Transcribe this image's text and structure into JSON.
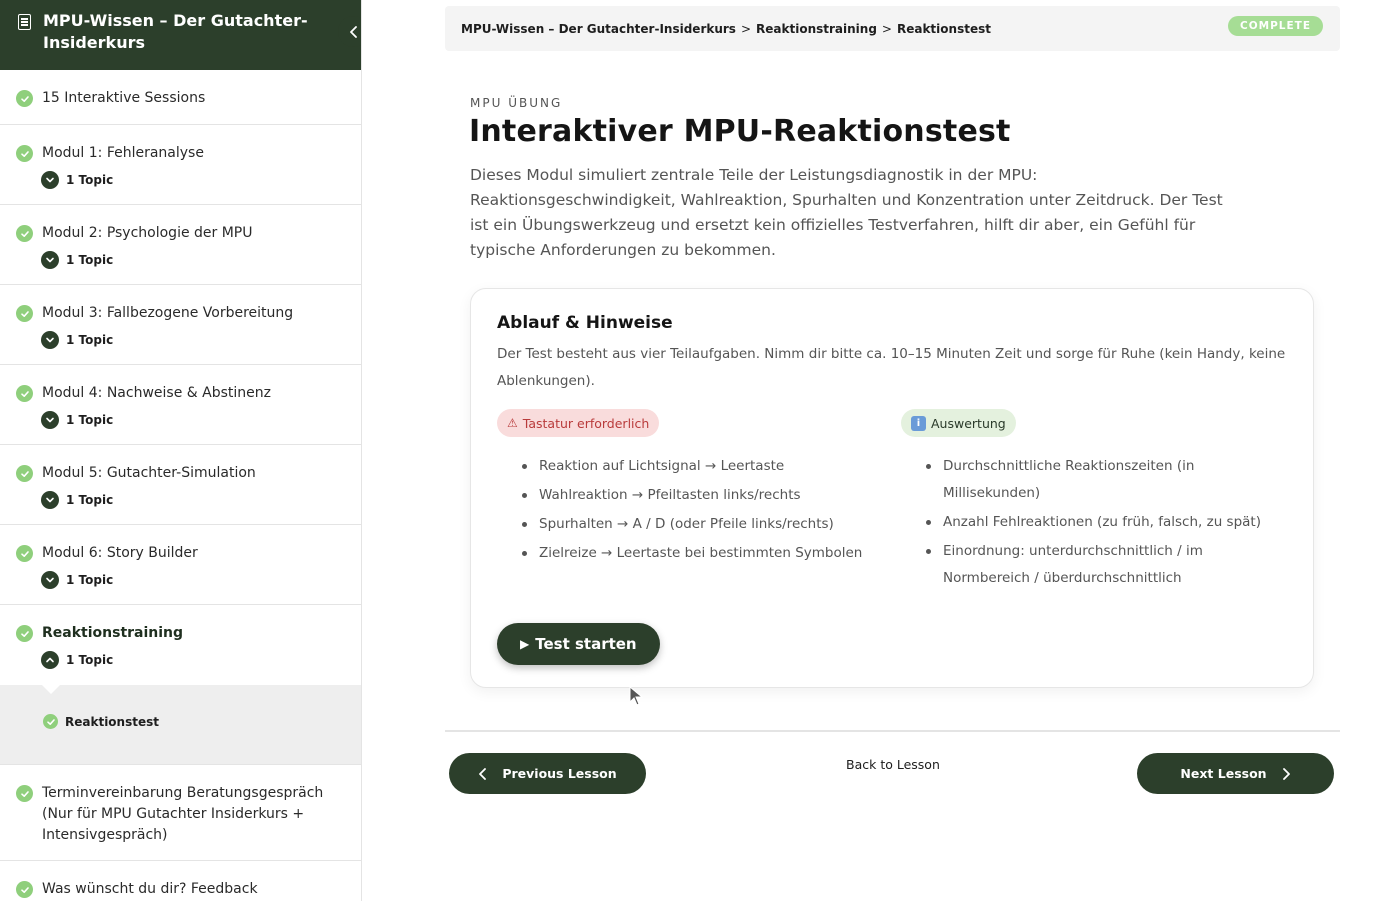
{
  "sidebar": {
    "title": "MPU-Wissen – Der Gutachter-Insiderkurs",
    "items": [
      {
        "label": "15 Interaktive Sessions"
      },
      {
        "label": "Modul 1: Fehleranalyse",
        "topics": "1 Topic"
      },
      {
        "label": "Modul 2: Psychologie der MPU",
        "topics": "1 Topic"
      },
      {
        "label": "Modul 3: Fallbezogene Vorbereitung",
        "topics": "1 Topic"
      },
      {
        "label": "Modul 4: Nachweise & Abstinenz",
        "topics": "1 Topic"
      },
      {
        "label": "Modul 5: Gutachter-Simulation",
        "topics": "1 Topic"
      },
      {
        "label": "Modul 6: Story Builder",
        "topics": "1 Topic"
      },
      {
        "label": "Reaktionstraining",
        "topics": "1 Topic"
      },
      {
        "label": "Terminvereinbarung Beratungsgespräch (Nur für MPU Gutachter Insiderkurs + Intensivgespräch)"
      },
      {
        "label": "Was wünscht du dir? Feedback"
      }
    ],
    "sub_item": "Reaktionstest"
  },
  "breadcrumb": {
    "items": [
      "MPU-Wissen – Der Gutachter-Insiderkurs",
      "Reaktionstraining",
      "Reaktionstest"
    ],
    "separator": ">",
    "status": "COMPLETE"
  },
  "lesson": {
    "eyebrow": "MPU ÜBUNG",
    "title": "Interaktiver MPU-Reaktionstest",
    "intro": "Dieses Modul simuliert zentrale Teile der Leistungsdiagnostik in der MPU: Reaktionsgeschwindigkeit, Wahlreaktion, Spurhalten und Konzentration unter Zeitdruck. Der Test ist ein Übungswerkzeug und ersetzt kein offizielles Testverfahren, hilft dir aber, ein Gefühl für typische Anforderungen zu bekommen."
  },
  "card": {
    "title": "Ablauf & Hinweise",
    "description": "Der Test besteht aus vier Teilaufgaben. Nimm dir bitte ca. 10–15 Minuten Zeit und sorge für Ruhe (kein Handy, keine Ablenkungen).",
    "warn_pill": "Tastatur erforderlich",
    "warn_icon": "⚠",
    "info_pill": "Auswertung",
    "info_icon": "i",
    "left_list": [
      "Reaktion auf Lichtsignal → Leertaste",
      "Wahlreaktion → Pfeiltasten links/rechts",
      "Spurhalten → A / D (oder Pfeile links/rechts)",
      "Zielreize → Leertaste bei bestimmten Symbolen"
    ],
    "right_list": [
      "Durchschnittliche Reaktionszeiten (in Millisekunden)",
      "Anzahl Fehlreaktionen (zu früh, falsch, zu spät)",
      "Einordnung: unterdurchschnittlich / im Normbereich / überdurchschnittlich"
    ],
    "start_button": "Test starten",
    "start_icon": "▶"
  },
  "navigation": {
    "previous": "Previous Lesson",
    "back": "Back to Lesson",
    "next": "Next Lesson"
  },
  "colors": {
    "brand_dark": "#2c3f2b",
    "check_green": "#8fcf7c",
    "complete_badge": "#a6dd95",
    "warn_bg": "#f9dcdc",
    "warn_text": "#b93b3b",
    "info_bg": "#e4f1de"
  }
}
